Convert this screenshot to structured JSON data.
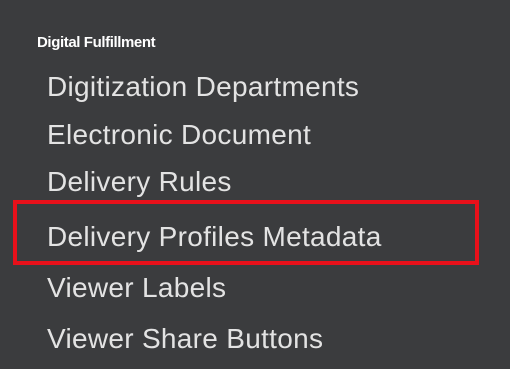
{
  "menu": {
    "section_heading": "Digital Fulfillment",
    "items": [
      {
        "label": "Digitization Departments"
      },
      {
        "label_line1": "Electronic Document",
        "label_line2": "Delivery Rules"
      },
      {
        "label": "Delivery Profiles Metadata",
        "highlighted": true
      },
      {
        "label": "Viewer Labels"
      },
      {
        "label": "Viewer Share Buttons"
      }
    ]
  },
  "colors": {
    "panel_background": "#3b3c3e",
    "item_text": "#e3e3e3",
    "heading_text": "#ffffff",
    "highlight_border": "#e8101a"
  }
}
